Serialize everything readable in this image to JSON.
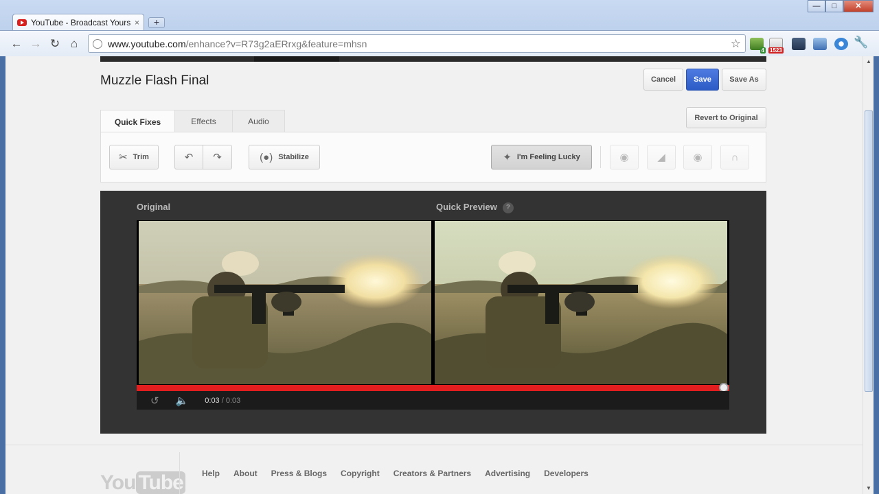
{
  "browser": {
    "tab_title": "YouTube - Broadcast Yours",
    "tab_close": "×",
    "new_tab": "+",
    "url_host": "www.youtube.com",
    "url_path": "/enhance?v=R73g2aERrxg&feature=mhsn",
    "window_buttons": {
      "minimize": "—",
      "maximize": "□",
      "close": "✕"
    },
    "extension_badges": {
      "green": "4",
      "mail": "1523"
    }
  },
  "editor": {
    "title": "Muzzle Flash Final",
    "buttons": {
      "cancel": "Cancel",
      "save": "Save",
      "save_as": "Save As",
      "revert": "Revert to Original"
    },
    "tabs": [
      {
        "label": "Quick Fixes"
      },
      {
        "label": "Effects"
      },
      {
        "label": "Audio"
      }
    ],
    "tools": {
      "trim": "Trim",
      "stabilize": "Stabilize",
      "feeling_lucky": "I'm Feeling Lucky"
    },
    "preview": {
      "original_label": "Original",
      "quick_preview_label": "Quick Preview",
      "help": "?",
      "current_time": "0:03",
      "duration": "/ 0:03",
      "progress": 1.0
    }
  },
  "footer": {
    "logo_you": "You",
    "logo_tube": "Tube",
    "links": [
      "Help",
      "About",
      "Press & Blogs",
      "Copyright",
      "Creators & Partners",
      "Advertising",
      "Developers"
    ]
  },
  "colors": {
    "accent_blue": "#2d5bc6",
    "progress_red": "#e21e1e",
    "panel_dark": "#333333"
  }
}
